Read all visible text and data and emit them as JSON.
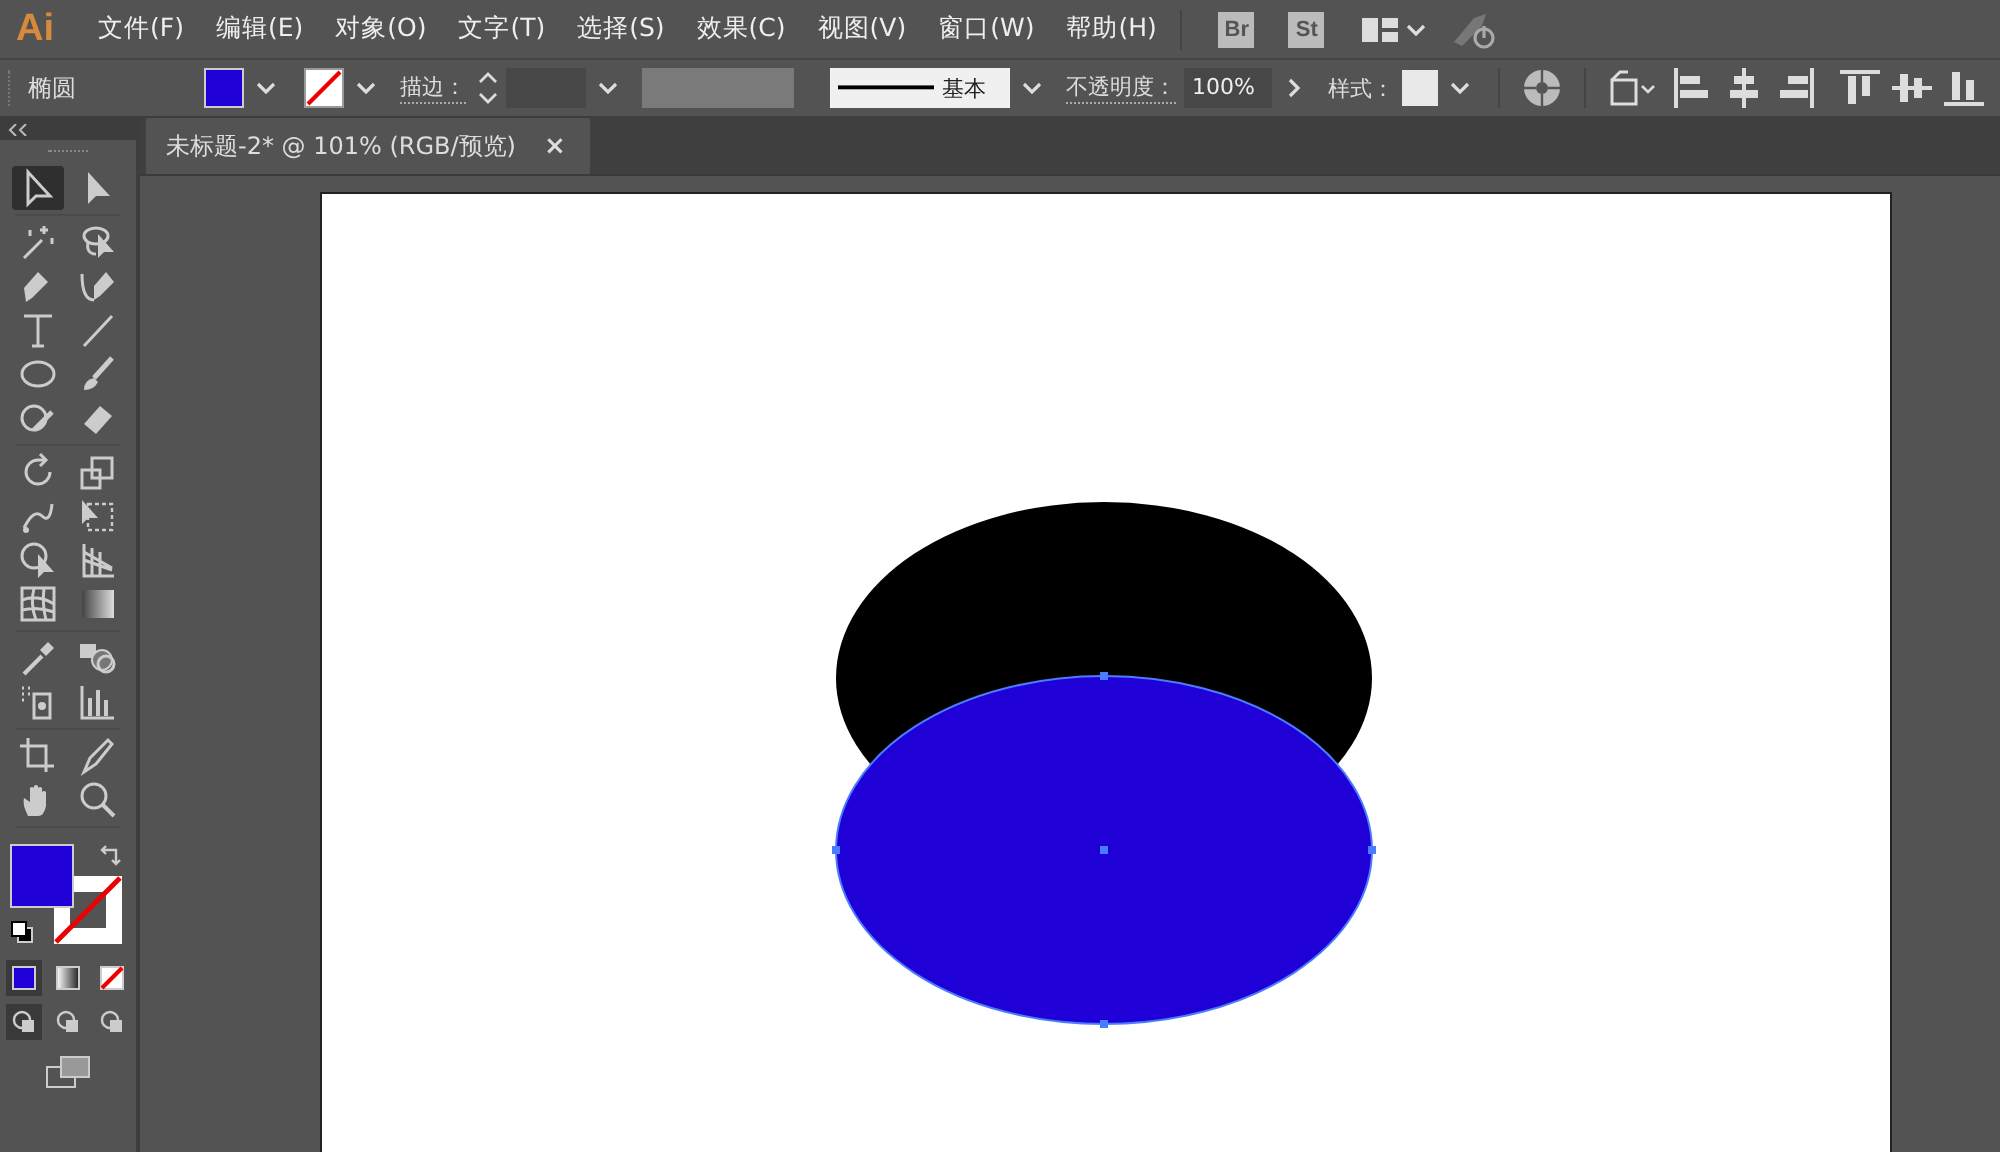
{
  "app": {
    "logo": "Ai"
  },
  "menu": [
    {
      "label": "文件(F)"
    },
    {
      "label": "编辑(E)"
    },
    {
      "label": "对象(O)"
    },
    {
      "label": "文字(T)"
    },
    {
      "label": "选择(S)"
    },
    {
      "label": "效果(C)"
    },
    {
      "label": "视图(V)"
    },
    {
      "label": "窗口(W)"
    },
    {
      "label": "帮助(H)"
    }
  ],
  "app_buttons": [
    {
      "label": "Br"
    },
    {
      "label": "St"
    }
  ],
  "control_bar": {
    "object_type": "椭圆",
    "fill": {
      "color": "#1f00d6"
    },
    "stroke_label": "描边：",
    "brush_label": "基本",
    "opacity_label": "不透明度：",
    "opacity_value": "100%",
    "style_label": "样式："
  },
  "document_tab": {
    "title": "未标题-2* @ 101% (RGB/预览)",
    "close": "×",
    "selected": true
  },
  "toolbox": {
    "tools": [
      {
        "selected": true
      },
      {
        "selected": false
      },
      {
        "selected": false
      },
      {
        "selected": false
      },
      {
        "selected": false
      },
      {
        "selected": false
      },
      {
        "selected": false
      },
      {
        "selected": false
      },
      {
        "selected": false
      },
      {
        "selected": false
      },
      {
        "selected": false
      },
      {
        "selected": false
      },
      {
        "selected": false
      },
      {
        "selected": false
      },
      {
        "selected": false
      },
      {
        "selected": false
      },
      {
        "selected": false
      },
      {
        "selected": false
      },
      {
        "selected": false
      },
      {
        "selected": false
      },
      {
        "selected": false
      },
      {
        "selected": false
      },
      {
        "selected": false
      },
      {
        "selected": false
      },
      {
        "selected": false
      },
      {
        "selected": false
      },
      {
        "selected": false
      },
      {
        "selected": false
      }
    ],
    "fill": {
      "color": "#1f00d6"
    }
  },
  "canvas": {
    "shapes": [
      {
        "kind": "ellipse",
        "color": "#000000",
        "selected": false
      },
      {
        "kind": "ellipse",
        "color": "#1f00d6",
        "selected": true
      }
    ]
  }
}
